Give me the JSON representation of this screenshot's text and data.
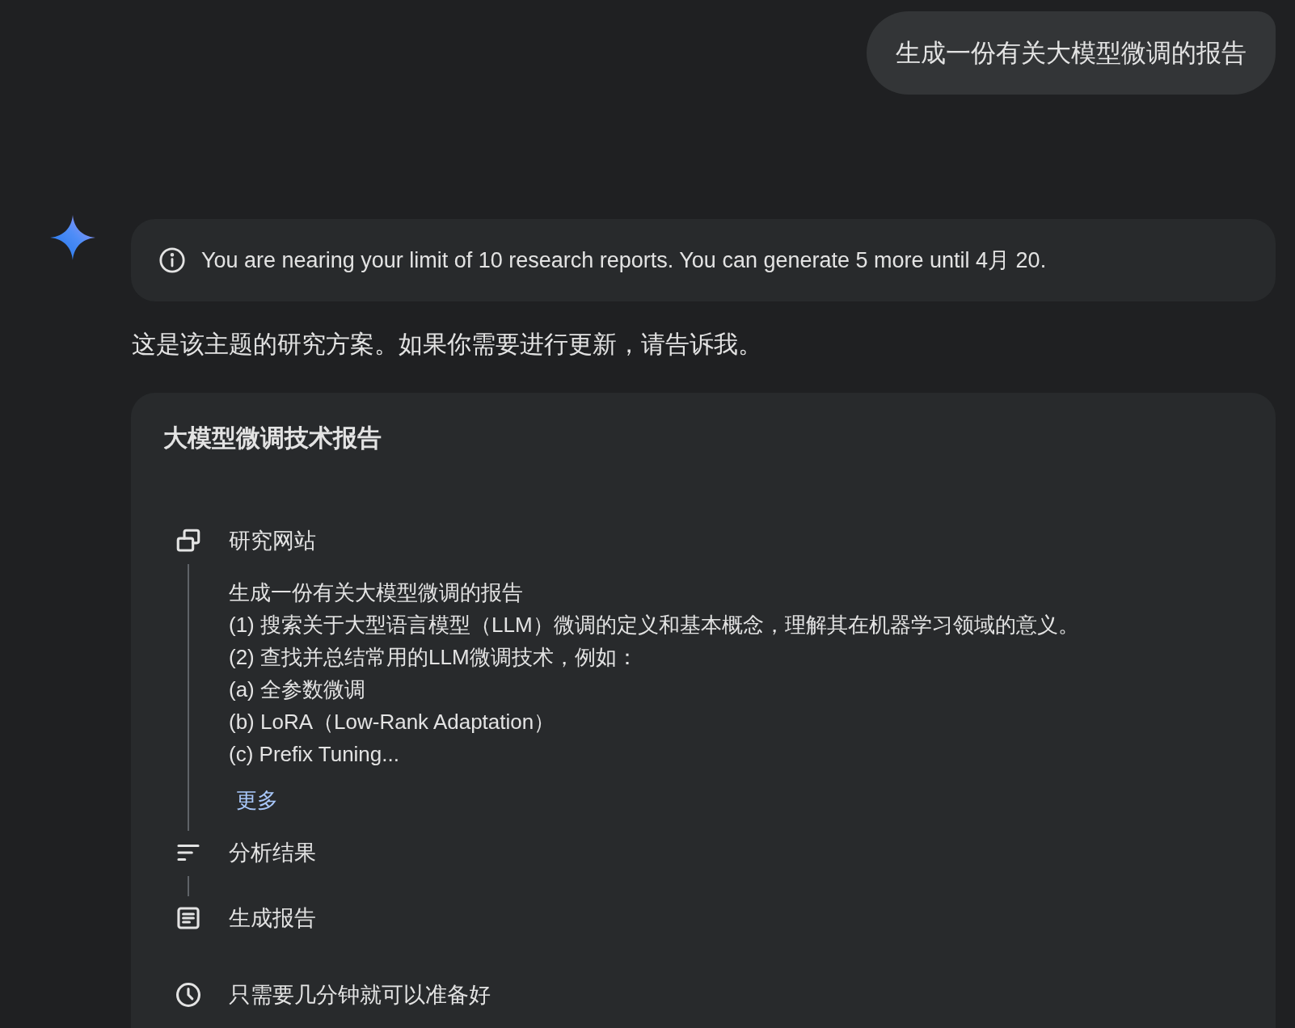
{
  "user_message": {
    "text": "生成一份有关大模型微调的报告"
  },
  "notice": {
    "text": "You are nearing your limit of 10 research reports. You can generate 5 more until 4月 20."
  },
  "response": {
    "intro": "这是该主题的研究方案。如果你需要进行更新，请告诉我。",
    "plan": {
      "title": "大模型微调技术报告",
      "steps": [
        {
          "kind": "browse",
          "label": "研究网站",
          "details": [
            "生成一份有关大模型微调的报告",
            "(1) 搜索关于大型语言模型（LLM）微调的定义和基本概念，理解其在机器学习领域的意义。",
            "(2) 查找并总结常用的LLM微调技术，例如：",
            "(a) 全参数微调",
            "(b) LoRA（Low-Rank Adaptation）",
            "(c) Prefix Tuning..."
          ],
          "more_link": "更多"
        },
        {
          "kind": "analyze",
          "label": "分析结果"
        },
        {
          "kind": "report",
          "label": "生成报告"
        }
      ],
      "duration": "只需要几分钟就可以准备好"
    }
  }
}
